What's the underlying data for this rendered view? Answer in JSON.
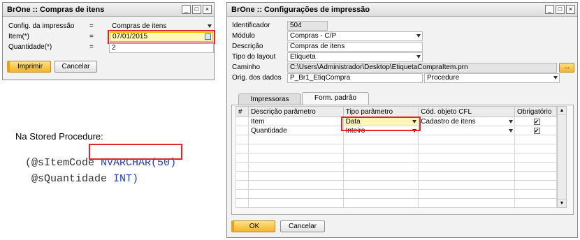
{
  "left_window": {
    "title": "BrOne :: Compras de itens",
    "rows": [
      {
        "label": "Config. da impressão",
        "eq": "=",
        "value": "Compras de itens"
      },
      {
        "label": "Item(*)",
        "eq": "=",
        "value": "07/01/2015"
      },
      {
        "label": "Quantidade(*)",
        "eq": "=",
        "value": "2"
      }
    ],
    "print_button": "Imprimir",
    "cancel_button": "Cancelar"
  },
  "annotation": {
    "caption": "Na Stored Procedure:",
    "line1_prefix": "(@sItemCode ",
    "line1_type": "NVARCHAR(50)",
    "line2_prefix": " @sQuantidade ",
    "line2_type": "INT)"
  },
  "right_window": {
    "title": "BrOne :: Configurações de impressão",
    "fields": {
      "identificador_label": "Identificador",
      "identificador_value": "504",
      "modulo_label": "Módulo",
      "modulo_value": "Compras - C/P",
      "descricao_label": "Descrição",
      "descricao_value": "Compras de itens",
      "tipo_layout_label": "Tipo do layout",
      "tipo_layout_value": "Etiqueta",
      "caminho_label": "Caminho",
      "caminho_value": "C:\\Users\\Administrador\\Desktop\\EtiquetaCompraItem.prn",
      "browse_label": "...",
      "orig_dados_label": "Orig. dos dados",
      "orig_dados_value": "P_Br1_EtiqCompra",
      "orig_dados_type": "Procedure"
    },
    "tabs": [
      "Impressoras",
      "Form. padrão"
    ],
    "grid": {
      "headers": [
        "#",
        "Descrição parâmetro",
        "Tipo parâmetro",
        "Cód. objeto CFL",
        "Obrigatório"
      ],
      "rows": [
        {
          "desc": "Item",
          "tipo": "Data",
          "cfl": "Cadastro de itens",
          "obrig": true
        },
        {
          "desc": "Quantidade",
          "tipo": "Inteiro",
          "cfl": "",
          "obrig": true
        }
      ]
    },
    "ok_button": "OK",
    "cancel_button": "Cancelar"
  }
}
